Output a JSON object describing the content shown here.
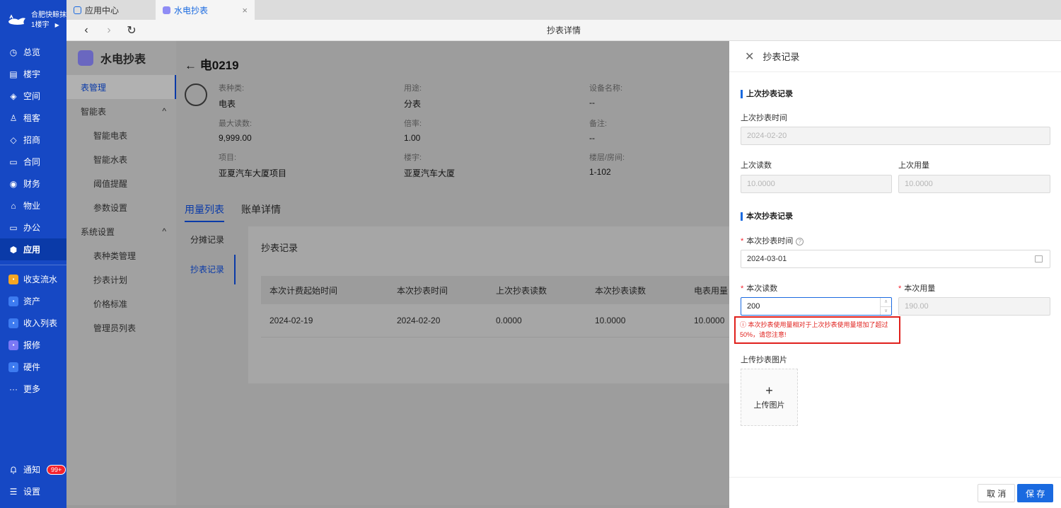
{
  "nav": {
    "org_name": "合肥快鲸抹",
    "building": "1楼宇",
    "items": [
      {
        "label": "总览",
        "icon": "clock-icon"
      },
      {
        "label": "楼宇",
        "icon": "building-icon"
      },
      {
        "label": "空间",
        "icon": "cube-icon"
      },
      {
        "label": "租客",
        "icon": "users-icon"
      },
      {
        "label": "招商",
        "icon": "tag-icon"
      },
      {
        "label": "合同",
        "icon": "document-icon"
      },
      {
        "label": "财务",
        "icon": "coin-icon"
      },
      {
        "label": "物业",
        "icon": "home-icon"
      },
      {
        "label": "办公",
        "icon": "monitor-icon"
      },
      {
        "label": "应用",
        "icon": "app-icon"
      }
    ],
    "apps": [
      {
        "label": "收支流水",
        "color": "#f6a623"
      },
      {
        "label": "资产",
        "color": "#3d7bf0"
      },
      {
        "label": "收入列表",
        "color": "#3d7bf0"
      },
      {
        "label": "报修",
        "color": "#7b78f5"
      },
      {
        "label": "硬件",
        "color": "#3d7bf0"
      }
    ],
    "more": "更多",
    "notice": "通知",
    "notice_badge": "99+",
    "settings": "设置"
  },
  "tabs": [
    {
      "label": "应用中心"
    },
    {
      "label": "水电抄表"
    }
  ],
  "address_title": "抄表详情",
  "submenu": {
    "title": "水电抄表",
    "items": [
      {
        "label": "表管理",
        "active": true,
        "level": 0
      },
      {
        "label": "智能表",
        "level": 0,
        "arrow": "^"
      },
      {
        "label": "智能电表",
        "level": 1
      },
      {
        "label": "智能水表",
        "level": 1
      },
      {
        "label": "阈值提醒",
        "level": 1
      },
      {
        "label": "参数设置",
        "level": 1
      },
      {
        "label": "系统设置",
        "level": 0,
        "arrow": "^"
      },
      {
        "label": "表种类管理",
        "level": 1
      },
      {
        "label": "抄表计划",
        "level": 1
      },
      {
        "label": "价格标准",
        "level": 1
      },
      {
        "label": "管理员列表",
        "level": 1
      }
    ]
  },
  "meter": {
    "title": "电0219",
    "fields": [
      {
        "label": "表种类:",
        "value": "电表"
      },
      {
        "label": "用途:",
        "value": "分表"
      },
      {
        "label": "设备名称:",
        "value": "--"
      },
      {
        "label": "最大读数:",
        "value": "9,999.00"
      },
      {
        "label": "倍率:",
        "value": "1.00"
      },
      {
        "label": "备注:",
        "value": "--"
      },
      {
        "label": "项目:",
        "value": "亚夏汽车大厦项目"
      },
      {
        "label": "楼宇:",
        "value": "亚夏汽车大厦"
      },
      {
        "label": "楼层/房间:",
        "value": "1-102"
      }
    ],
    "tabs": [
      "用量列表",
      "账单详情"
    ],
    "side_tabs": [
      "分摊记录",
      "抄表记录"
    ],
    "card_title": "抄表记录",
    "table": {
      "headers": [
        "本次计费起始时间",
        "本次抄表时间",
        "上次抄表读数",
        "本次抄表读数",
        "电表用量"
      ],
      "rows": [
        [
          "2024-02-19",
          "2024-02-20",
          "0.0000",
          "10.0000",
          "10.0000"
        ]
      ]
    }
  },
  "drawer": {
    "title": "抄表记录",
    "last_section": "上次抄表记录",
    "last_time_label": "上次抄表时间",
    "last_time_value": "2024-02-20",
    "last_reading_label": "上次读数",
    "last_reading_value": "10.0000",
    "last_usage_label": "上次用量",
    "last_usage_value": "10.0000",
    "current_section": "本次抄表记录",
    "current_time_label": "本次抄表时间",
    "current_time_value": "2024-03-01",
    "current_reading_label": "本次读数",
    "current_reading_value": "200",
    "current_usage_label": "本次用量",
    "current_usage_value": "190.00",
    "warning": "本次抄表使用量相对于上次抄表使用量增加了超过 50%，请您注意!",
    "upload_label": "上传抄表图片",
    "upload_button": "上传图片",
    "cancel": "取 消",
    "save": "保 存"
  }
}
